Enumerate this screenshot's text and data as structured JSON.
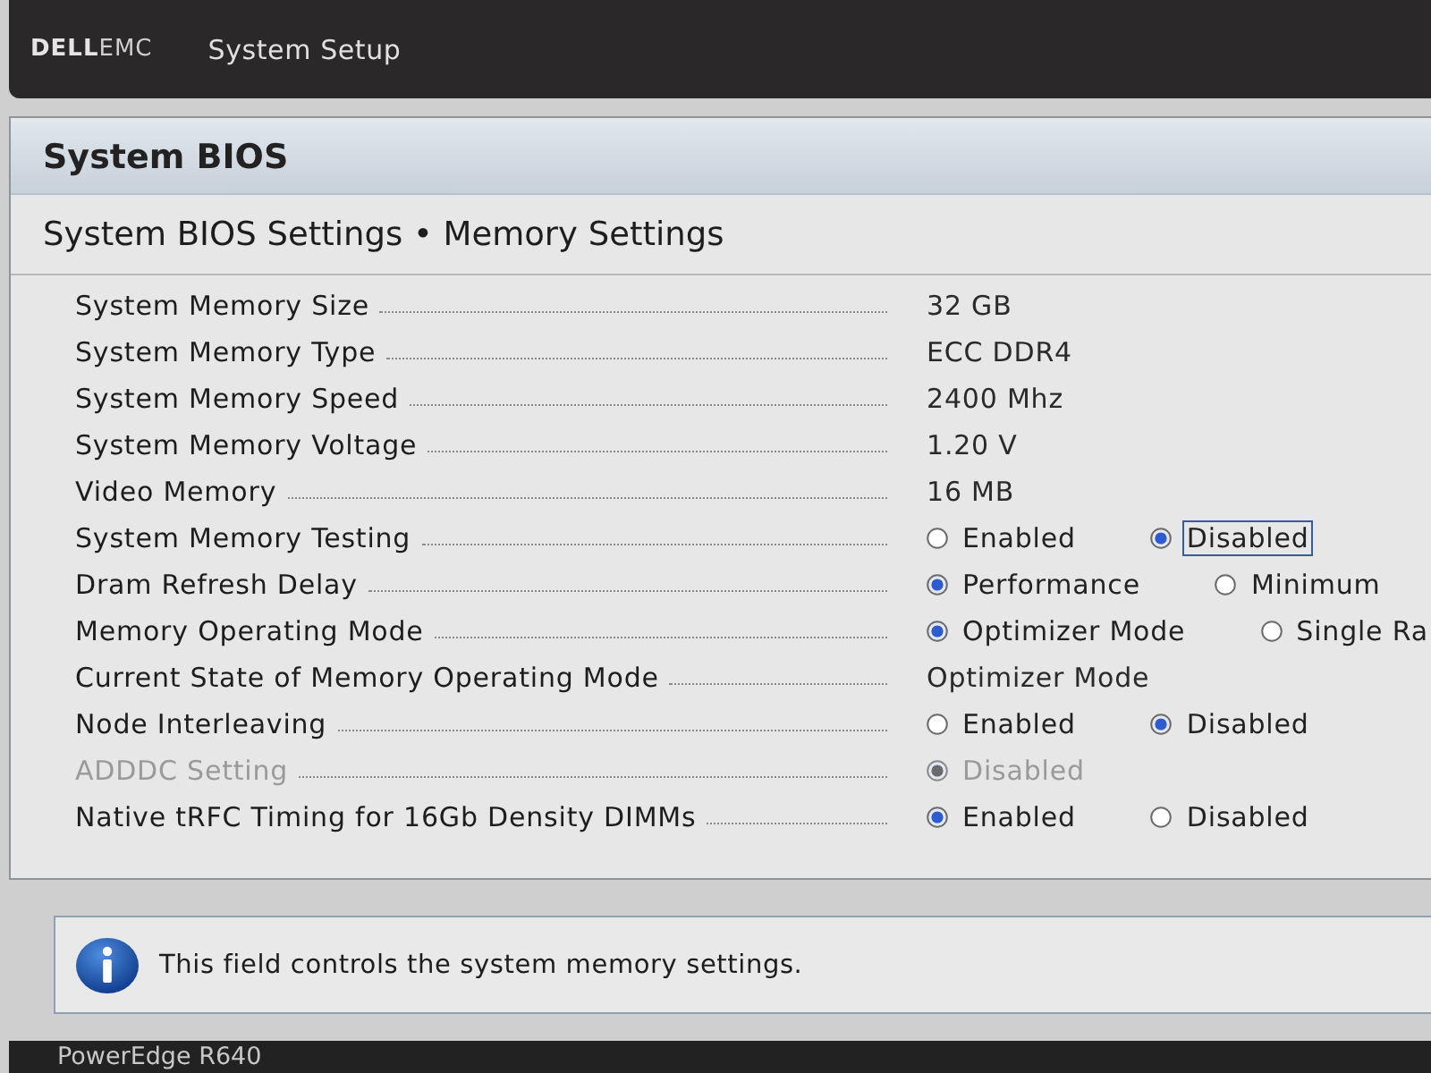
{
  "header": {
    "logo": {
      "primary": "DELL",
      "secondary": "EMC"
    },
    "title": "System Setup"
  },
  "panel": {
    "title": "System BIOS",
    "subtitle": "System BIOS Settings • Memory Settings",
    "rows": [
      {
        "label": "System Memory Size",
        "disabled": false,
        "kind": "text",
        "value": "32 GB"
      },
      {
        "label": "System Memory Type",
        "disabled": false,
        "kind": "text",
        "value": "ECC DDR4"
      },
      {
        "label": "System Memory Speed",
        "disabled": false,
        "kind": "text",
        "value": "2400 Mhz"
      },
      {
        "label": "System Memory Voltage",
        "disabled": false,
        "kind": "text",
        "value": "1.20 V"
      },
      {
        "label": "Video Memory",
        "disabled": false,
        "kind": "text",
        "value": "16 MB"
      },
      {
        "label": "System Memory Testing",
        "disabled": false,
        "kind": "radio",
        "options": [
          {
            "label": "Enabled",
            "selected": false,
            "focused": false
          },
          {
            "label": "Disabled",
            "selected": true,
            "focused": true
          }
        ]
      },
      {
        "label": "Dram Refresh Delay",
        "disabled": false,
        "kind": "radio",
        "options": [
          {
            "label": "Performance",
            "selected": true,
            "focused": false
          },
          {
            "label": "Minimum",
            "selected": false,
            "focused": false
          }
        ]
      },
      {
        "label": "Memory Operating Mode",
        "disabled": false,
        "kind": "radio",
        "options": [
          {
            "label": "Optimizer Mode",
            "selected": true,
            "focused": false
          },
          {
            "label": "Single Ra",
            "selected": false,
            "focused": false
          }
        ]
      },
      {
        "label": "Current State of Memory Operating Mode",
        "disabled": false,
        "kind": "text",
        "value": "Optimizer Mode"
      },
      {
        "label": "Node Interleaving",
        "disabled": false,
        "kind": "radio",
        "options": [
          {
            "label": "Enabled",
            "selected": false,
            "focused": false
          },
          {
            "label": "Disabled",
            "selected": true,
            "focused": false
          }
        ]
      },
      {
        "label": "ADDDC Setting",
        "disabled": true,
        "kind": "radio",
        "options": [
          {
            "label": "Disabled",
            "selected": true,
            "focused": false
          }
        ]
      },
      {
        "label": "Native tRFC Timing for 16Gb Density DIMMs",
        "disabled": false,
        "kind": "radio",
        "options": [
          {
            "label": "Enabled",
            "selected": true,
            "focused": false
          },
          {
            "label": "Disabled",
            "selected": false,
            "focused": false
          }
        ]
      }
    ]
  },
  "help": {
    "text": "This field controls the system memory settings."
  },
  "footer": {
    "model": "PowerEdge R640"
  }
}
